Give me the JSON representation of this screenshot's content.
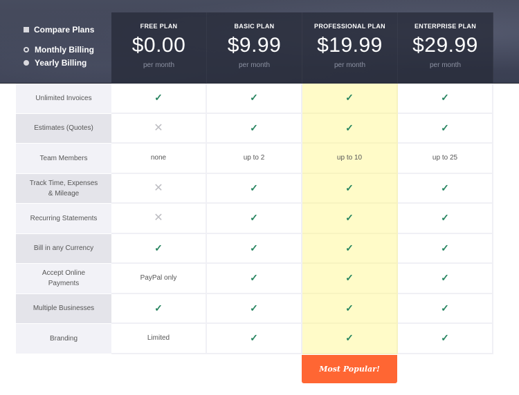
{
  "controls": {
    "compare_label": "Compare Plans",
    "billing_options": [
      {
        "label": "Monthly Billing",
        "selected": true
      },
      {
        "label": "Yearly Billing",
        "selected": false
      }
    ]
  },
  "plans": [
    {
      "name": "FREE PLAN",
      "price": "$0.00",
      "period": "per month"
    },
    {
      "name": "BASIC PLAN",
      "price": "$9.99",
      "period": "per month"
    },
    {
      "name": "PROFESSIONAL PLAN",
      "price": "$19.99",
      "period": "per month",
      "highlighted": true
    },
    {
      "name": "ENTERPRISE PLAN",
      "price": "$29.99",
      "period": "per month"
    }
  ],
  "features": [
    {
      "label": "Unlimited Invoices",
      "values": [
        "check",
        "check",
        "check",
        "check"
      ]
    },
    {
      "label": "Estimates (Quotes)",
      "values": [
        "cross",
        "check",
        "check",
        "check"
      ]
    },
    {
      "label": "Team Members",
      "values": [
        "none",
        "up to 2",
        "up to 10",
        "up to 25"
      ]
    },
    {
      "label": "Track Time, Expenses & Mileage",
      "values": [
        "cross",
        "check",
        "check",
        "check"
      ]
    },
    {
      "label": "Recurring Statements",
      "values": [
        "cross",
        "check",
        "check",
        "check"
      ]
    },
    {
      "label": "Bill in any Currency",
      "values": [
        "check",
        "check",
        "check",
        "check"
      ]
    },
    {
      "label": "Accept Online Payments",
      "values": [
        "PayPal only",
        "check",
        "check",
        "check"
      ]
    },
    {
      "label": "Multiple Businesses",
      "values": [
        "check",
        "check",
        "check",
        "check"
      ]
    },
    {
      "label": "Branding",
      "values": [
        "Limited",
        "check",
        "check",
        "check"
      ]
    }
  ],
  "icons": {
    "check": "✓",
    "cross": "✕"
  },
  "badge": {
    "label": "Most Popular!"
  },
  "colors": {
    "check": "#26845f",
    "highlight": "#fffbc8",
    "badge": "#ff6633"
  }
}
